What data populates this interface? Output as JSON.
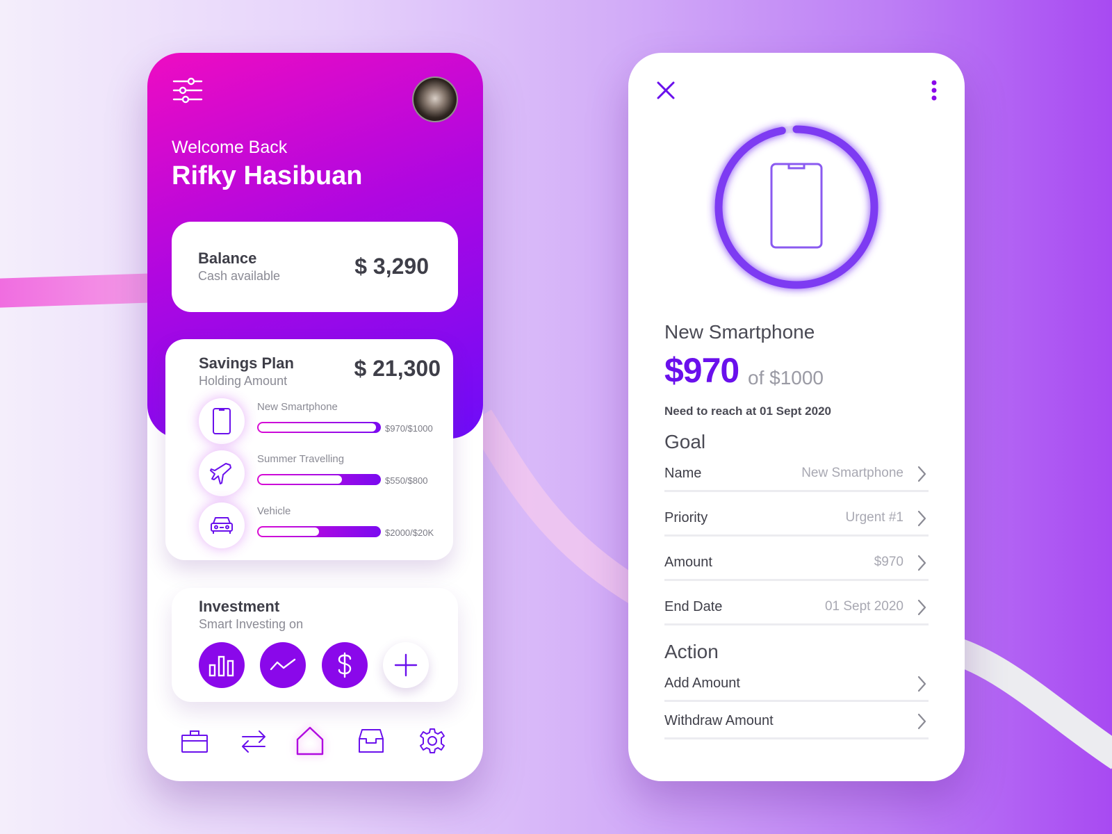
{
  "colors": {
    "accent": "#8a08ea",
    "accent_dark": "#6a10ec",
    "gradient_start": "#ee0cc2",
    "gradient_end": "#6d0cf8",
    "text_dark": "#3e3e48",
    "text_muted": "#8a8a94"
  },
  "home": {
    "filter_icon": "sliders-icon",
    "avatar_icon": "avatar",
    "welcome": "Welcome Back",
    "user_name": "Rifky Hasibuan",
    "balance": {
      "title": "Balance",
      "subtitle": "Cash available",
      "amount": "$ 3,290"
    },
    "savings": {
      "title": "Savings Plan",
      "subtitle": "Holding Amount",
      "amount": "$ 21,300",
      "goals": [
        {
          "name": "New Smartphone",
          "value": "$970/$1000",
          "progress": 0.97,
          "icon": "smartphone-icon"
        },
        {
          "name": "Summer Travelling",
          "value": "$550/$800",
          "progress": 0.69,
          "icon": "airplane-icon"
        },
        {
          "name": "Vehicle",
          "value": "$2000/$20K",
          "progress": 0.5,
          "icon": "car-icon"
        }
      ]
    },
    "investment": {
      "title": "Investment",
      "subtitle": "Smart Investing on",
      "options": [
        "bar-chart-icon",
        "line-chart-icon",
        "dollar-icon",
        "plus-icon"
      ]
    },
    "nav": [
      "briefcase-icon",
      "transfer-icon",
      "home-icon",
      "inbox-icon",
      "settings-icon"
    ],
    "nav_active": "home-icon"
  },
  "detail": {
    "close_icon": "close-icon",
    "more_icon": "more-vertical-icon",
    "goal_icon": "smartphone-icon",
    "progress": 0.97,
    "title": "New Smartphone",
    "amount": "$970",
    "of_target": "of $1000",
    "deadline": "Need to reach at 01 Sept 2020",
    "goal_section": "Goal",
    "goal_fields": [
      {
        "label": "Name",
        "value": "New Smartphone"
      },
      {
        "label": "Priority",
        "value": "Urgent #1"
      },
      {
        "label": "Amount",
        "value": "$970"
      },
      {
        "label": "End Date",
        "value": "01 Sept 2020"
      }
    ],
    "action_section": "Action",
    "actions": [
      {
        "label": "Add Amount"
      },
      {
        "label": "Withdraw Amount"
      }
    ]
  }
}
